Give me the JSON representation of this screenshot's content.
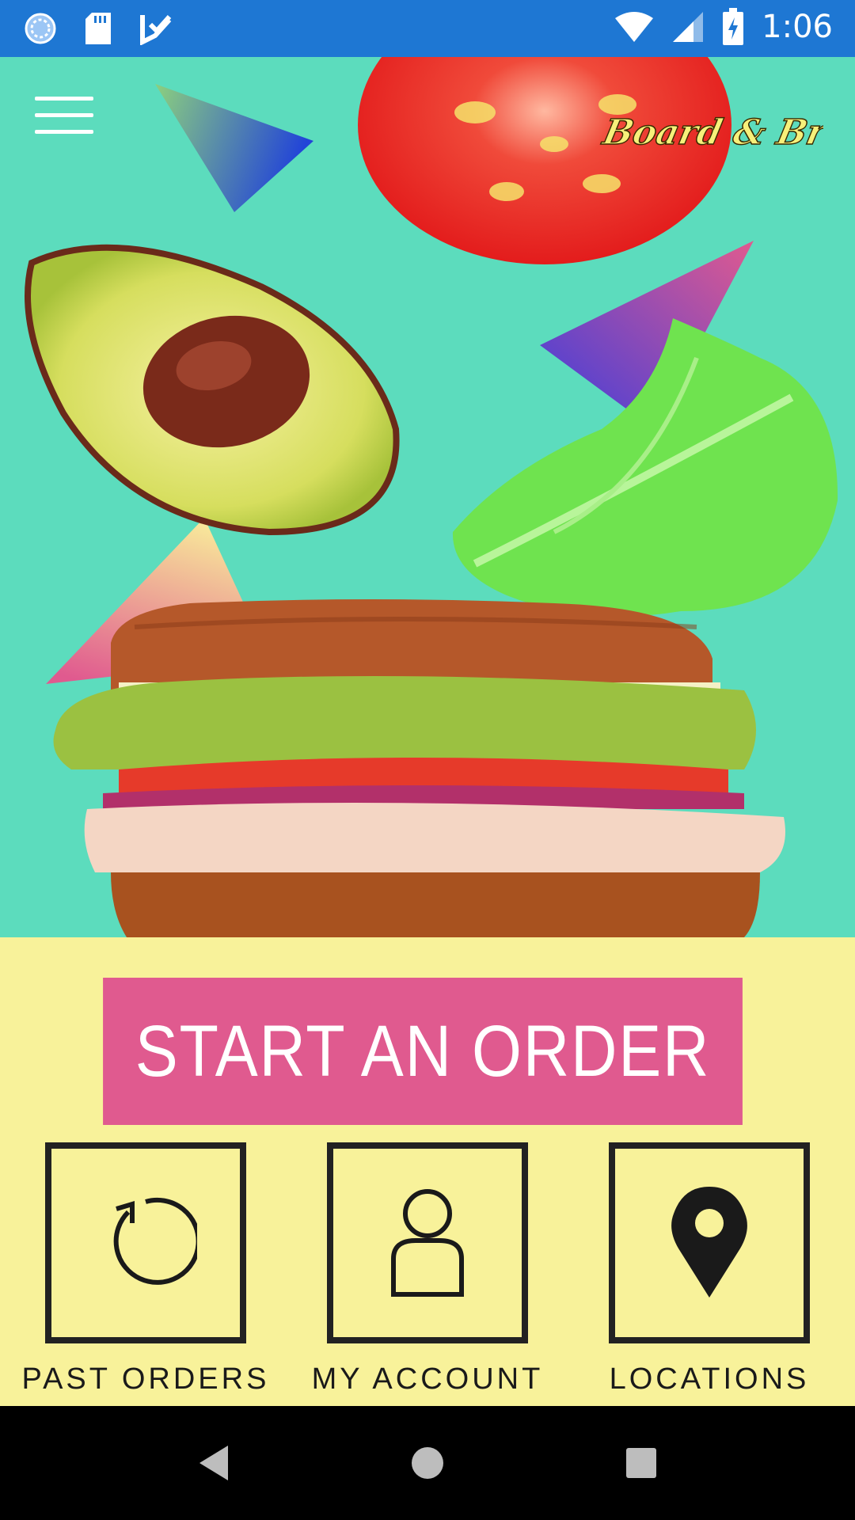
{
  "status_bar": {
    "time": "1:06",
    "icons": [
      "sync-icon",
      "sd-card-icon",
      "task-check-icon",
      "wifi-icon",
      "signal-icon",
      "battery-charging-icon"
    ]
  },
  "header": {
    "menu_icon": "hamburger-menu-icon",
    "logo_text": "Board & Brew"
  },
  "hero": {
    "background_color": "#5cdcbd"
  },
  "actions": {
    "start_order_label": "START AN ORDER",
    "tiles": [
      {
        "label": "PAST ORDERS",
        "icon": "history-icon"
      },
      {
        "label": "MY ACCOUNT",
        "icon": "person-icon"
      },
      {
        "label": "LOCATIONS",
        "icon": "location-pin-icon"
      }
    ]
  },
  "colors": {
    "status_bar": "#1e77d3",
    "panel": "#f8f29a",
    "accent": "#e05a8f"
  },
  "nav_bar": {
    "icons": [
      "back-icon",
      "home-icon",
      "recents-icon"
    ]
  }
}
